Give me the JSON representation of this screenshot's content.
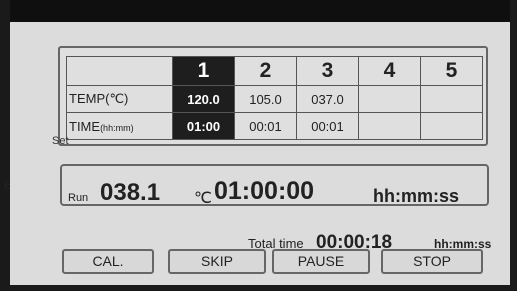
{
  "table": {
    "columns": [
      "1",
      "2",
      "3",
      "4",
      "5"
    ],
    "temp_label": "TEMP(℃)",
    "time_label": "TIME",
    "time_unit": "(hh:mm)",
    "set_label": "Set",
    "temp_values": [
      "120.0",
      "105.0",
      "037.0",
      "",
      ""
    ],
    "time_values": [
      "01:00",
      "00:01",
      "00:01",
      "",
      ""
    ]
  },
  "run": {
    "label": "Run",
    "temp": "038.1",
    "temp_unit": "℃",
    "time": "01:00:00",
    "time_format": "hh:mm:ss"
  },
  "total": {
    "label": "Total time",
    "value": "00:00:18",
    "format": "hh:mm:ss"
  },
  "buttons": {
    "cal": "CAL.",
    "skip": "SKIP",
    "pause": "PAUSE",
    "stop": "STOP"
  },
  "side_text": "e",
  "colors": {
    "active_cell": "#1e1e1e",
    "screen": "#dcdcdc"
  }
}
